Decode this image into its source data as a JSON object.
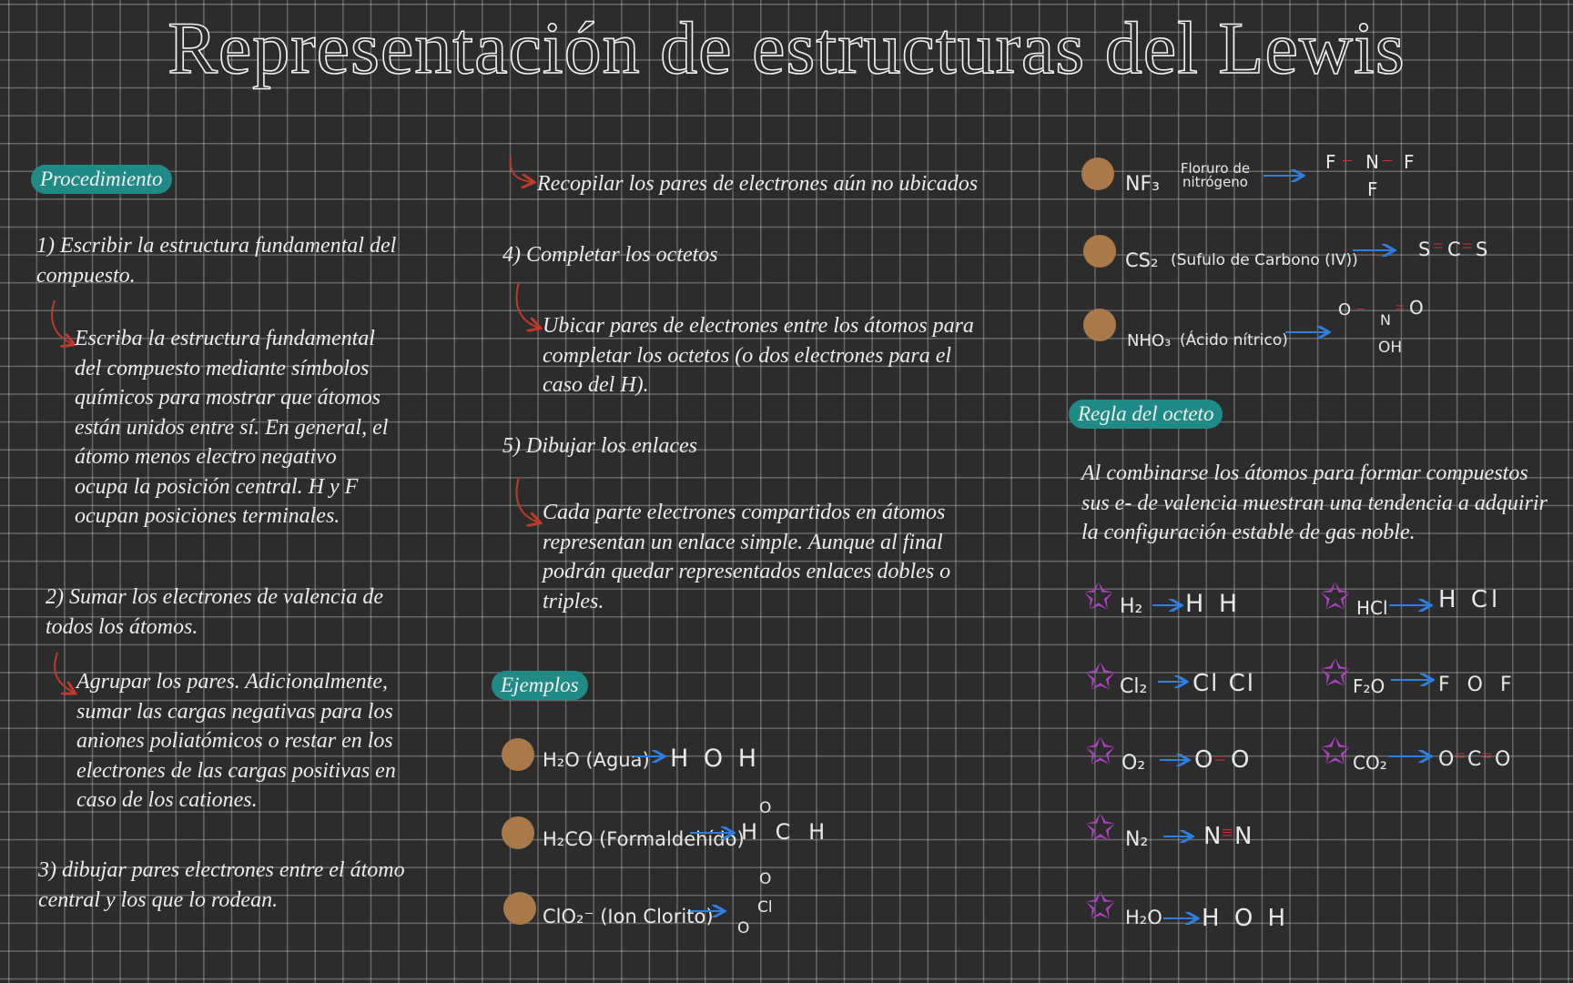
{
  "title": "Representación de estructuras del Lewis",
  "colors": {
    "accent": "#1f8a86",
    "arrow_red": "#c0392b",
    "dot_brown": "#a9794a",
    "star_purple": "#b23fc8",
    "arrow_blue": "#2f7fe0"
  },
  "procedimiento": {
    "label": "Procedimiento",
    "step1": "1) Escribir la estructura fundamental del compuesto.",
    "step1_detail": "Escriba la estructura fundamental del compuesto mediante símbolos químicos para mostrar que átomos están unidos entre sí. En general, el átomo menos electro negativo ocupa la posición central. H y F ocupan posiciones terminales.",
    "step2": "2) Sumar los electrones de valencia de todos los átomos.",
    "step2_detail": "Agrupar los pares. Adicionalmente, sumar las cargas negativas para los aniones poliatómicos o restar en los electrones de las cargas positivas en caso de los cationes.",
    "step3": "3) dibujar pares electrones entre el átomo central y los que lo rodean."
  },
  "middle": {
    "step3_detail": "Recopilar los pares de electrones aún no ubicados",
    "step4": "4) Completar los octetos",
    "step4_detail": "Ubicar pares de electrones entre los átomos para completar los octetos (o dos electrones para el caso del H).",
    "step5": "5) Dibujar los enlaces",
    "step5_detail": "Cada parte electrones compartidos en átomos representan un enlace simple. Aunque al final podrán quedar representados enlaces dobles o triples."
  },
  "ejemplos": {
    "label": "Ejemplos",
    "items": [
      {
        "formula": "H₂O (Agua)",
        "result": "H O H"
      },
      {
        "formula": "H₂CO (Formaldehído)",
        "result": "H C H",
        "top": "O"
      },
      {
        "formula": "ClO₂⁻ (Ion Clorito)",
        "atoms": [
          "O",
          "Cl",
          "O"
        ]
      }
    ]
  },
  "right_examples": [
    {
      "formula": "NF₃",
      "name": "Floruro de nitrógeno",
      "result": [
        "F",
        "N",
        "F"
      ],
      "bottom": "F"
    },
    {
      "formula": "CS₂",
      "name": "(Sufulo de Carbono (IV))",
      "result": [
        "S",
        "C",
        "S"
      ]
    },
    {
      "formula": "NHO₃",
      "name": "(Ácido nítrico)",
      "result": [
        "O",
        "N",
        "O"
      ],
      "bottom": "OH"
    }
  ],
  "regla": {
    "label": "Regla del octeto",
    "text": "Al combinarse los átomos para formar compuestos sus e- de valencia muestran una tendencia a adquirir la configuración estable de gas noble.",
    "left": [
      {
        "formula": "H₂",
        "result": "H H"
      },
      {
        "formula": "Cl₂",
        "result": "Cl Cl"
      },
      {
        "formula": "O₂",
        "a": "O",
        "b": "O"
      },
      {
        "formula": "N₂",
        "a": "N",
        "b": "N"
      },
      {
        "formula": "H₂O",
        "result": "H O H"
      }
    ],
    "right": [
      {
        "formula": "HCl",
        "result": "H Cl"
      },
      {
        "formula": "F₂O",
        "result": "F O F"
      },
      {
        "formula": "CO₂",
        "a": "O",
        "b": "C",
        "c": "O"
      }
    ]
  }
}
